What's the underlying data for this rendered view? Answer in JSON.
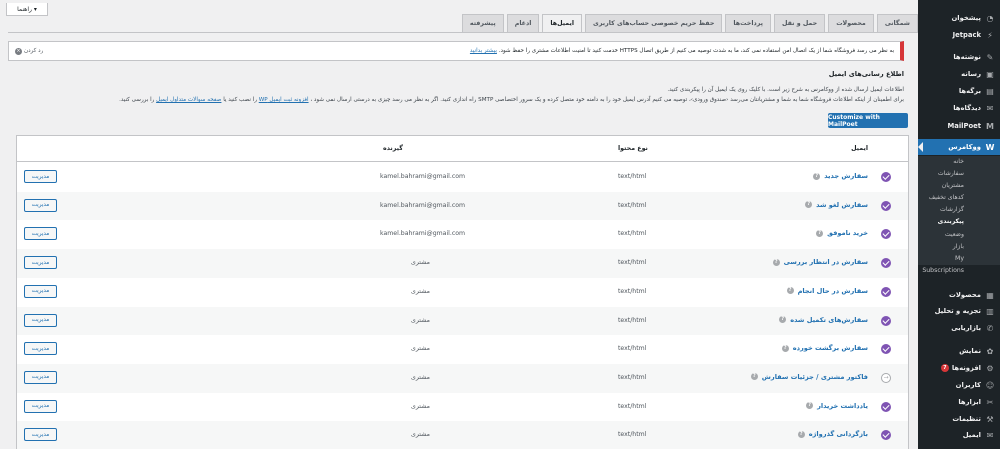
{
  "help_button": {
    "label": "راهنما",
    "arrow": "▾"
  },
  "tabs": [
    "شمگانی",
    "محصولات",
    "حمل و نقل",
    "پرداخت‌ها",
    "حفظ حریم خصوصی حساب‌های کاربری",
    "ایمیل‌ها",
    "ادغام",
    "پیشرفته"
  ],
  "active_tab_index": 5,
  "notice": {
    "message": "به نظر می رسد فروشگاه شما از یک اتصال امن استفاده نمی کند، ما به شدت توصیه می کنیم از طریق اتصال HTTPS خدمت کنید تا امنیت اطلاعات مشتری را حفظ شود.",
    "link": "بیشتر بدانید",
    "dismiss": "رد کردن"
  },
  "section": {
    "title": "اطلاع رسانی‌های ایمیل",
    "line1": "اطلاعات ایمیل ارسال شده از ووکامرس به شرح زیر است. با کلیک روی یک ایمیل آن را پیکربندی کنید.",
    "line2_a": "برای اطمینان از اینکه اطلاعات فروشگاه شما به شما و مشتریانتان می‌رسد ‹صندوق ورودی›، توصیه می کنیم آدرس ایمیل خود را به دامنه خود متصل کرده و یک سرور اختصاصی SMTP راه اندازی کنید. اگر به نظر می رسد چیزی به درستی ارسال نمی شود ،",
    "line2_link1": "افزونه ثبت ایمیل WP",
    "line2_b": " را نصب کنید یا",
    "line2_link2": "صفحه سوالات متداول ایمیل",
    "line2_c": " را بررسی کنید."
  },
  "mailpoet_button": "Customize with MailPoet",
  "table": {
    "headers": {
      "email": "ایمیل",
      "content_type": "نوع محتوا",
      "recipient": "گیرنده"
    },
    "manage_label": "مدیریت",
    "rows": [
      {
        "name": "سفارش جدید",
        "enabled": true,
        "type": "text/html",
        "recipient": "kamel.bahrami@gmail.com"
      },
      {
        "name": "سفارش لغو شد",
        "enabled": true,
        "type": "text/html",
        "recipient": "kamel.bahrami@gmail.com"
      },
      {
        "name": "خرید ناموفق",
        "enabled": true,
        "type": "text/html",
        "recipient": "kamel.bahrami@gmail.com"
      },
      {
        "name": "سفارش در انتظار بررسی",
        "enabled": true,
        "type": "text/html",
        "recipient": "مشتری"
      },
      {
        "name": "سفارش در حال انجام",
        "enabled": true,
        "type": "text/html",
        "recipient": "مشتری"
      },
      {
        "name": "سفارش‌های تکمیل شده",
        "enabled": true,
        "type": "text/html",
        "recipient": "مشتری"
      },
      {
        "name": "سفارش برگشت خورده",
        "enabled": true,
        "type": "text/html",
        "recipient": "مشتری"
      },
      {
        "name": "فاکتور مشتری / جزئیات سفارش",
        "enabled": false,
        "type": "text/html",
        "recipient": "مشتری"
      },
      {
        "name": "یادداشت خریدار",
        "enabled": true,
        "type": "text/html",
        "recipient": "مشتری"
      },
      {
        "name": "بازگردانی گذرواژه",
        "enabled": true,
        "type": "text/html",
        "recipient": "مشتری"
      }
    ]
  },
  "sidebar": {
    "top": [
      {
        "label": "پیشخوان",
        "icon": "dashboard-icon",
        "glyph": "◔"
      },
      {
        "label": "Jetpack",
        "icon": "jetpack-icon",
        "glyph": "⚡"
      },
      {
        "label": "نوشته‌ها",
        "icon": "pin-icon",
        "glyph": "✎"
      },
      {
        "label": "رسانه",
        "icon": "media-icon",
        "glyph": "▣"
      },
      {
        "label": "برگه‌ها",
        "icon": "pages-icon",
        "glyph": "▤"
      },
      {
        "label": "دیدگاه‌ها",
        "icon": "comments-icon",
        "glyph": "✉"
      },
      {
        "label": "MailPoet",
        "icon": "mailpoet-icon",
        "glyph": "M"
      },
      {
        "label": "ووکامرس",
        "icon": "woocommerce-icon",
        "glyph": "W"
      }
    ],
    "woo_sub": [
      "خانه",
      "سفارشات",
      "مشتریان",
      "کدهای تخفیف",
      "گزارشات",
      "پیکربندی",
      "وضعیت",
      "بازار",
      "My Subscriptions"
    ],
    "woo_sub_current": 5,
    "bottom": [
      {
        "label": "محصولات",
        "icon": "products-icon",
        "glyph": "▦"
      },
      {
        "label": "تجزیه و تحلیل",
        "icon": "analytics-icon",
        "glyph": "▥"
      },
      {
        "label": "بازاریابی",
        "icon": "marketing-icon",
        "glyph": "✆"
      },
      {
        "label": "نمایش",
        "icon": "appearance-icon",
        "glyph": "✿"
      },
      {
        "label": "افزونه‌ها",
        "icon": "plugins-icon",
        "glyph": "⚙",
        "badge": "7"
      },
      {
        "label": "کاربران",
        "icon": "users-icon",
        "glyph": "☺"
      },
      {
        "label": "ابزارها",
        "icon": "tools-icon",
        "glyph": "✂"
      },
      {
        "label": "تنظیمات",
        "icon": "settings-icon",
        "glyph": "⚒"
      },
      {
        "label": "ایمیل",
        "icon": "email-icon",
        "glyph": "✉"
      }
    ]
  }
}
